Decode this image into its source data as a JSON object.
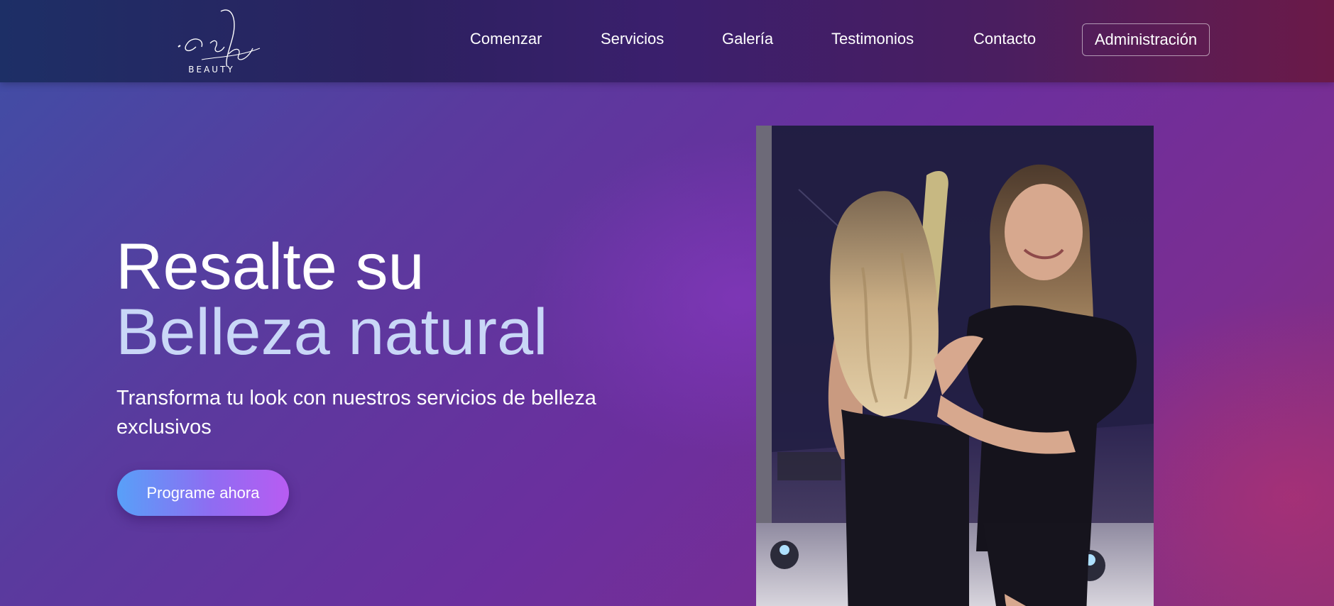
{
  "brand": {
    "logo_script": "Pelis",
    "logo_word": "BEAUTY"
  },
  "nav": {
    "items": [
      {
        "label": "Comenzar"
      },
      {
        "label": "Servicios"
      },
      {
        "label": "Galería"
      },
      {
        "label": "Testimonios"
      },
      {
        "label": "Contacto"
      }
    ],
    "admin_label": "Administración"
  },
  "hero": {
    "title": "Resalte su",
    "title_accent": "Belleza natural",
    "subtitle": "Transforma tu look con nuestros servicios de belleza exclusivos",
    "cta_label": "Programe ahora",
    "photo_alt": "stylist-with-client-photo"
  },
  "colors": {
    "nav_bg_start": "#1d2f66",
    "nav_bg_end": "#6b1a48",
    "accent_text": "#c9d7f7",
    "cta_start": "#58a0f8",
    "cta_end": "#b85cf2"
  }
}
